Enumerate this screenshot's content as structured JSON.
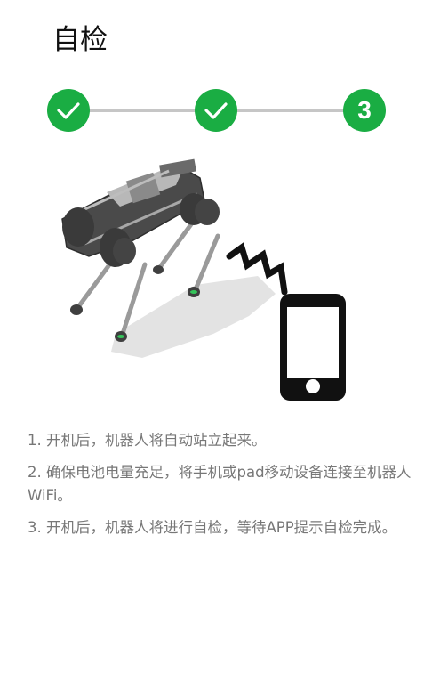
{
  "title": "自检",
  "steps": [
    {
      "state": "done",
      "icon": "check-icon"
    },
    {
      "state": "done",
      "icon": "check-icon"
    },
    {
      "state": "current",
      "label": "3"
    }
  ],
  "colors": {
    "accent": "#1aad43",
    "connector": "#c6c6c6",
    "instruction_text": "#777777"
  },
  "illustration": {
    "robot": "robot-dog-image",
    "signal": "wireless-signal-icon",
    "phone": "smartphone-icon"
  },
  "instructions": [
    "1. 开机后，机器人将自动站立起来。",
    "2. 确保电池电量充足，将手机或pad移动设备连接至机器人WiFi。",
    "3. 开机后，机器人将进行自检，等待APP提示自检完成。"
  ]
}
